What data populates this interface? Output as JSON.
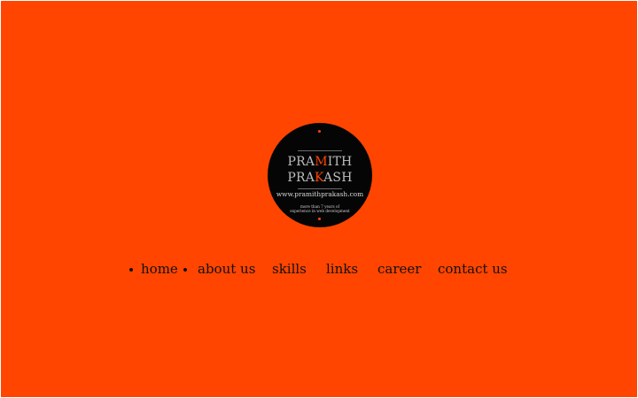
{
  "logo": {
    "name_first_a": "PRA",
    "name_first_accent": "M",
    "name_first_b": "ITH",
    "name_last_a": "PRA",
    "name_last_accent": "K",
    "name_last_b": "ASH",
    "website": "www.pramithprakash.com",
    "tagline_line1": "more than 7 years of",
    "tagline_line2": "experience in web development"
  },
  "nav": {
    "items": [
      {
        "label": "home"
      },
      {
        "label": "about us"
      },
      {
        "label": "skills"
      },
      {
        "label": "links"
      },
      {
        "label": "career"
      },
      {
        "label": "contact us"
      }
    ]
  },
  "colors": {
    "background": "#ff4500",
    "logo_circle": "#050505",
    "accent": "#ff4500",
    "nav_text": "#111111"
  }
}
